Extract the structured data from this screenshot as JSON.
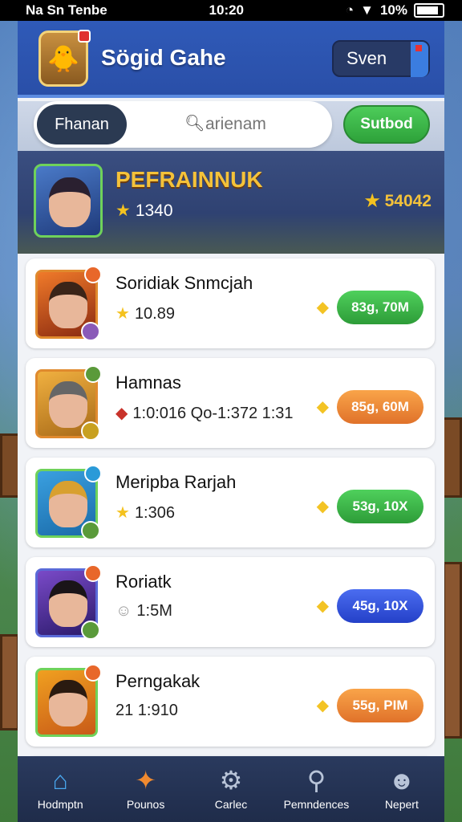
{
  "status_bar": {
    "carrier": "Na Sn Tenbe",
    "time": "10:20",
    "battery": "10%"
  },
  "header": {
    "title": "Sögid Gahe",
    "sign_in_label": "Sven"
  },
  "search": {
    "filter_label": "Fhanan",
    "placeholder": "arienam",
    "submit_label": "Sutbod"
  },
  "featured": {
    "name": "PEFRAINNUK",
    "score": "1340",
    "points": "54042"
  },
  "players": [
    {
      "name": "Soridiak Snmcjah",
      "meta": "10.89",
      "reward": "83g, 70M",
      "reward_color": "green"
    },
    {
      "name": "Hamnas",
      "meta": "1:0:016  Qo-1:372 1:31",
      "reward": "85g, 60M",
      "reward_color": "orange"
    },
    {
      "name": "Meripba Rarjah",
      "meta": "1:306",
      "reward": "53g, 10X",
      "reward_color": "green"
    },
    {
      "name": "Roriatk",
      "meta": "1:5M",
      "reward": "45g, 10X",
      "reward_color": "blue"
    },
    {
      "name": "Perngakak",
      "meta": "21  1:910",
      "reward": "55g, PIM",
      "reward_color": "orange"
    }
  ],
  "bottom_nav": [
    {
      "label": "Hodmptn",
      "icon": "home-icon"
    },
    {
      "label": "Pounos",
      "icon": "fox-icon"
    },
    {
      "label": "Carlec",
      "icon": "gear-icon"
    },
    {
      "label": "Pemndences",
      "icon": "search-icon"
    },
    {
      "label": "Nepert",
      "icon": "profile-icon"
    }
  ]
}
